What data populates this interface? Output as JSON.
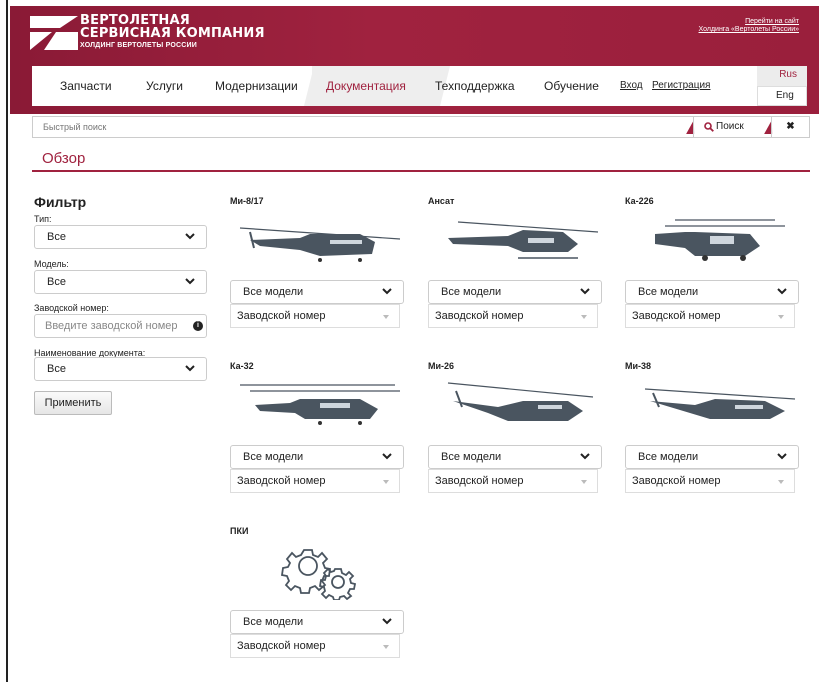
{
  "header": {
    "logo_line1": "ВЕРТОЛЕТНАЯ",
    "logo_line2": "СЕРВИСНАЯ КОМПАНИЯ",
    "logo_line3": "ХОЛДИНГ ВЕРТОЛЕТЫ РОССИИ",
    "holding_line1": "Перейти на сайт",
    "holding_line2": "Холдинга «Вертолеты России»"
  },
  "nav": {
    "items": [
      "Запчасти",
      "Услуги",
      "Модернизации",
      "Документация",
      "Техподдержка",
      "Обучение"
    ],
    "active": "Документация",
    "login": "Вход",
    "register": "Регистрация",
    "lang_rus": "Rus",
    "lang_eng": "Eng"
  },
  "search": {
    "placeholder": "Быстрый поиск",
    "button": "Поиск",
    "clear": "✖"
  },
  "page_title": "Обзор",
  "filter": {
    "title": "Фильтр",
    "type_label": "Тип:",
    "type_value": "Все",
    "model_label": "Модель:",
    "model_value": "Все",
    "serial_label": "Заводской номер:",
    "serial_placeholder": "Введите заводской номер",
    "doc_label": "Наименование документа:",
    "doc_value": "Все",
    "apply": "Применить"
  },
  "cards": [
    {
      "name": "Ми-8/17",
      "model_select": "Все модели",
      "serial_select": "Заводской номер"
    },
    {
      "name": "Ансат",
      "model_select": "Все модели",
      "serial_select": "Заводской номер"
    },
    {
      "name": "Ка-226",
      "model_select": "Все модели",
      "serial_select": "Заводской номер"
    },
    {
      "name": "Ка-32",
      "model_select": "Все модели",
      "serial_select": "Заводской номер"
    },
    {
      "name": "Ми-26",
      "model_select": "Все модели",
      "serial_select": "Заводской номер"
    },
    {
      "name": "Ми-38",
      "model_select": "Все модели",
      "serial_select": "Заводской номер"
    },
    {
      "name": "ПКИ",
      "model_select": "Все модели",
      "serial_select": "Заводской номер"
    }
  ],
  "colors": {
    "brand": "#a0223f",
    "header_bg": "#8a1a36",
    "helicopter": "#4a5560"
  }
}
